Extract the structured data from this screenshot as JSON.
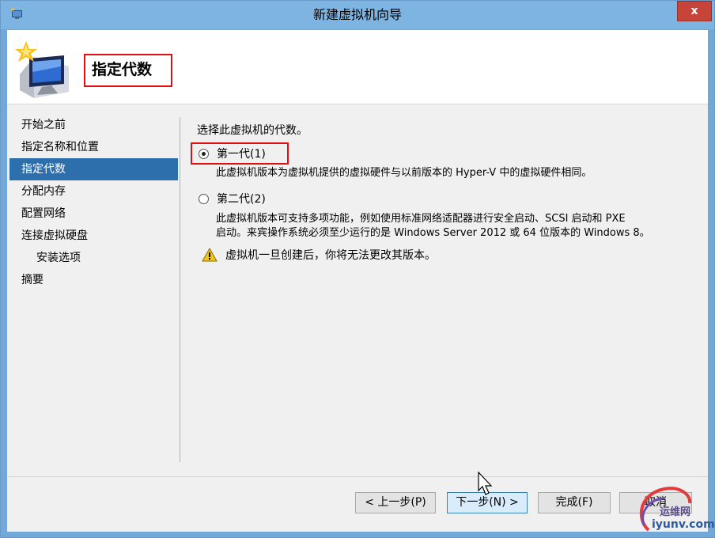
{
  "window": {
    "title": "新建虚拟机向导",
    "close_glyph": "x"
  },
  "header": {
    "title": "指定代数"
  },
  "nav": {
    "items": [
      {
        "label": "开始之前"
      },
      {
        "label": "指定名称和位置"
      },
      {
        "label": "指定代数"
      },
      {
        "label": "分配内存"
      },
      {
        "label": "配置网络"
      },
      {
        "label": "连接虚拟硬盘"
      },
      {
        "label": "安装选项"
      },
      {
        "label": "摘要"
      }
    ],
    "active_index": 2
  },
  "main": {
    "prompt": "选择此虚拟机的代数。",
    "option1": {
      "label": "第一代(1)",
      "selected": true,
      "description": "此虚拟机版本为虚拟机提供的虚拟硬件与以前版本的 Hyper-V 中的虚拟硬件相同。"
    },
    "option2": {
      "label": "第二代(2)",
      "selected": false,
      "description_line1": "此虚拟机版本可支持多项功能，例如使用标准网络适配器进行安全启动、SCSI 启动和 PXE",
      "description_line2": "启动。来宾操作系统必须至少运行的是 Windows Server 2012 或 64 位版本的 Windows 8。"
    },
    "warning": "虚拟机一旦创建后，你将无法更改其版本。"
  },
  "buttons": {
    "prev": "< 上一步(P)",
    "next": "下一步(N) >",
    "finish": "完成(F)",
    "cancel": "取消"
  },
  "watermark": {
    "line1": "运维网",
    "line2": "iyunv.com"
  },
  "colors": {
    "highlight": "#e01010",
    "nav_active": "#2d6fad",
    "titlebar": "#7eb4e2",
    "close": "#c7443a"
  }
}
